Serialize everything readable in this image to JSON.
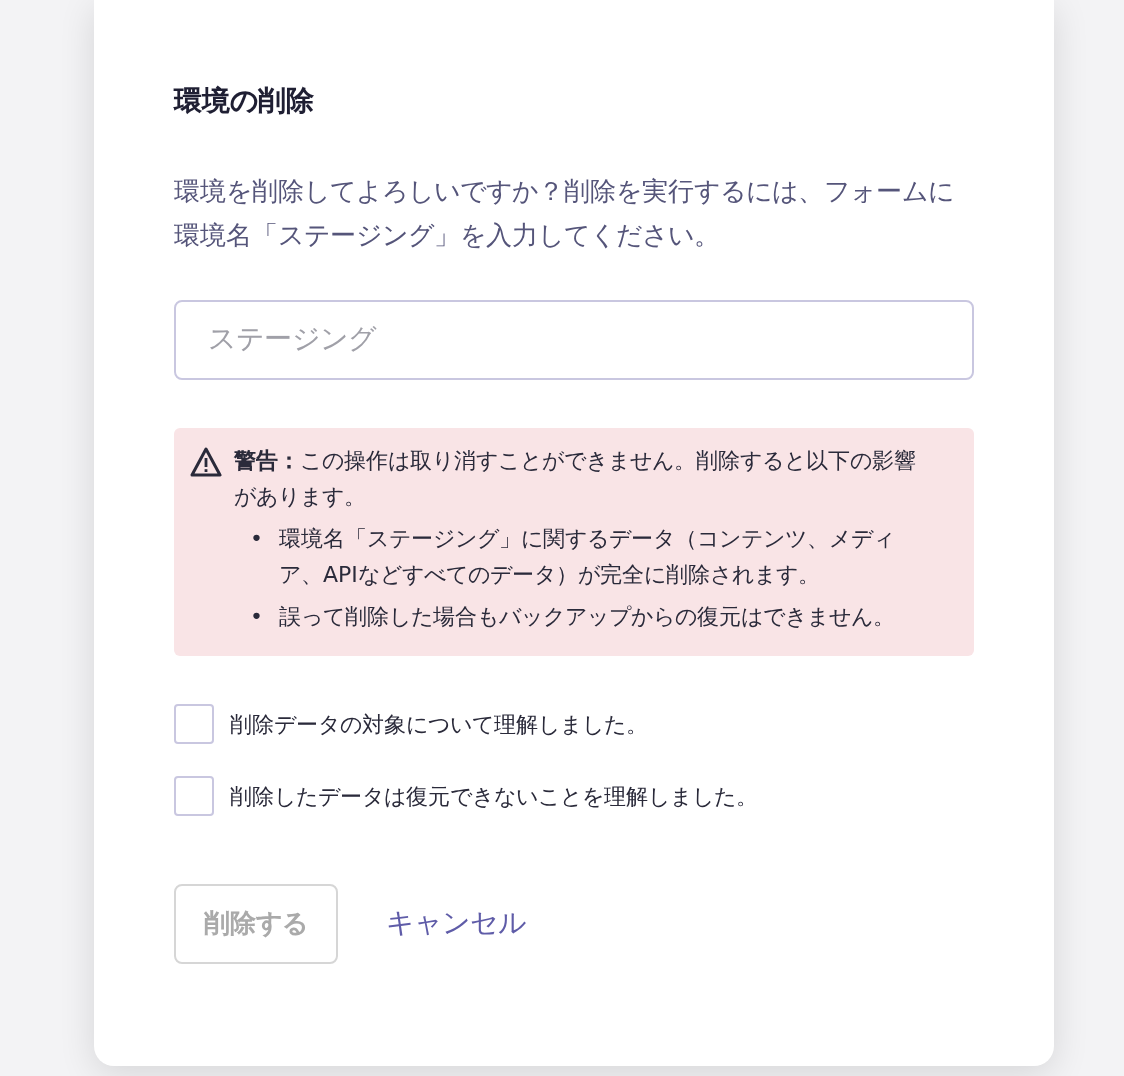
{
  "dialog": {
    "title": "環境の削除",
    "description": "環境を削除してよろしいですか？削除を実行するには、フォームに環境名「ステージング」を入力してください。",
    "input": {
      "placeholder": "ステージング"
    },
    "warning": {
      "label": "警告：",
      "text": "この操作は取り消すことができません。削除すると以下の影響があります。",
      "items": [
        {
          "bullet": "•",
          "text": "環境名「ステージング」に関するデータ（コンテンツ、メディア、APIなどすべてのデータ）が完全に削除されます。"
        },
        {
          "bullet": "•",
          "text": "誤って削除した場合もバックアップからの復元はできません。"
        }
      ]
    },
    "checkboxes": [
      {
        "label": "削除データの対象について理解しました。",
        "checked": false
      },
      {
        "label": "削除したデータは復元できないことを理解しました。",
        "checked": false
      }
    ],
    "delete_button": {
      "label": "削除する",
      "disabled": true
    },
    "cancel_link": "キャンセル"
  }
}
